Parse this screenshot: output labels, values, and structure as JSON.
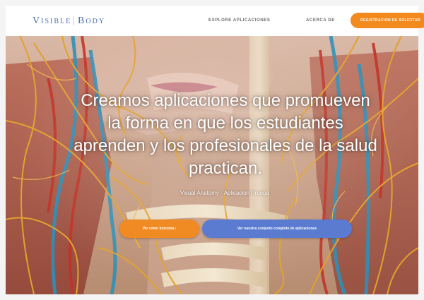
{
  "brand": {
    "logo_left": "Visible",
    "logo_sep": "|",
    "logo_right": "Body"
  },
  "nav": {
    "explore": "EXPLORE APLICACIONES",
    "about": "ACERCA DE",
    "cta": "REGISTRACIÓN DE SOLICITUD"
  },
  "hero": {
    "headline": "Creamos aplicaciones que promueven la forma en que los estudiantes aprenden y los profesionales de la salud practican.",
    "subline": "Visual Anatomy - Aplicación Prueba",
    "primary_button": "Ver cómo funciona ›",
    "secondary_button": "Ver nuestra conjunto completo de aplicaciones"
  },
  "colors": {
    "brand_blue": "#4a6fb0",
    "accent_orange": "#f08a23",
    "button_blue": "#5a7bd0",
    "nerve_yellow": "#e2a12c",
    "artery_red": "#c23227",
    "vein_blue": "#2d8fb8"
  }
}
